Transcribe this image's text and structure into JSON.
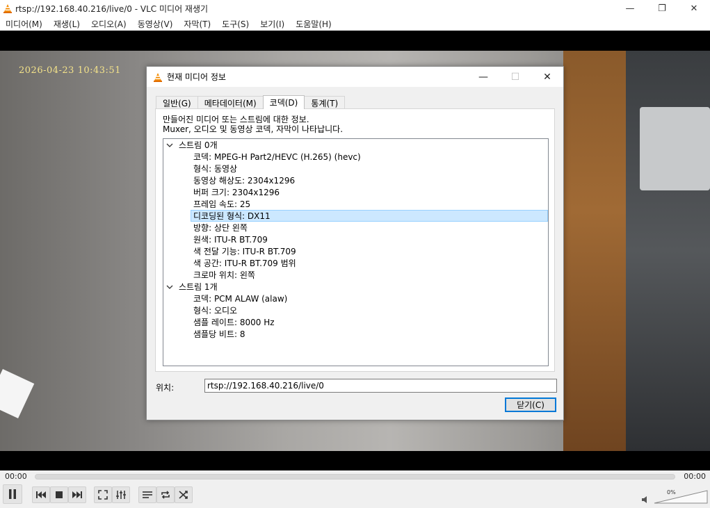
{
  "window": {
    "title": "rtsp://192.168.40.216/live/0 - VLC 미디어 재생기",
    "minimize_symbol": "—",
    "restore_symbol": "❐",
    "close_symbol": "✕"
  },
  "menu": [
    "미디어(M)",
    "재생(L)",
    "오디오(A)",
    "동영상(V)",
    "자막(T)",
    "도구(S)",
    "보기(I)",
    "도움말(H)"
  ],
  "video": {
    "osd_timestamp": "2026-04-23   10:43:51"
  },
  "dialog": {
    "title": "현재 미디어 정보",
    "tabs": [
      "일반(G)",
      "메타데이터(M)",
      "코덱(D)",
      "통계(T)"
    ],
    "active_tab": "코덱(D)",
    "description_line1": "만들어진 미디어 또는 스트림에 대한 정보.",
    "description_line2": "Muxer, 오디오 및 동영상 코덱, 자막이 나타납니다.",
    "streams": [
      {
        "label": "스트림 0개",
        "items": [
          "코덱: MPEG-H Part2/HEVC (H.265) (hevc)",
          "형식: 동영상",
          "동영상 해상도: 2304x1296",
          "버퍼 크기: 2304x1296",
          "프레임 속도: 25",
          "디코딩된 형식: DX11",
          "방향: 상단 왼쪽",
          "원색: ITU-R BT.709",
          "색 전달 기능: ITU-R BT.709",
          "색 공간: ITU-R BT.709 범위",
          "크로마 위치: 왼쪽"
        ]
      },
      {
        "label": "스트림 1개",
        "items": [
          "코덱: PCM ALAW (alaw)",
          "형식: 오디오",
          "샘플 레이트: 8000 Hz",
          "샘플당 비트: 8"
        ]
      }
    ],
    "selected_item": "디코딩된 형식: DX11",
    "location_label": "위치:",
    "location_value": "rtsp://192.168.40.216/live/0",
    "close_button": "닫기(C)"
  },
  "controls": {
    "elapsed": "00:00",
    "total": "00:00",
    "volume_percent": "0%",
    "buttons": [
      "pause-icon",
      "previous-icon",
      "stop-icon",
      "next-icon",
      "fullscreen-icon",
      "extended-settings-icon",
      "playlist-icon",
      "loop-icon",
      "shuffle-icon"
    ]
  }
}
